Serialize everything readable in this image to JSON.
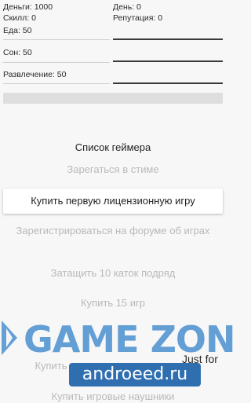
{
  "stats": {
    "money": "Деньги: 1000",
    "day": "День: 0",
    "skill": "Скилл: 0",
    "reputation": "Репутация: 0",
    "food": "Еда: 50",
    "sleep": "Сон: 50",
    "fun": "Развлечение: 50"
  },
  "progress": {
    "value": 0
  },
  "list": {
    "title": "Список геймера",
    "items": [
      "Зарегаться в стиме",
      "Купить первую лицензионную игру",
      "Зарегистрироваться на форуме об играх",
      "Затащить 10 каток подряд",
      "Купить 15 игр",
      "Купить",
      "Купить игровые наушники"
    ]
  },
  "watermark": {
    "logo": "GAME ZON",
    "tagline": "Just for",
    "site": "androeed.ru"
  },
  "colors": {
    "accent": "#4a8fcf",
    "badge": "#2f6fb0"
  }
}
